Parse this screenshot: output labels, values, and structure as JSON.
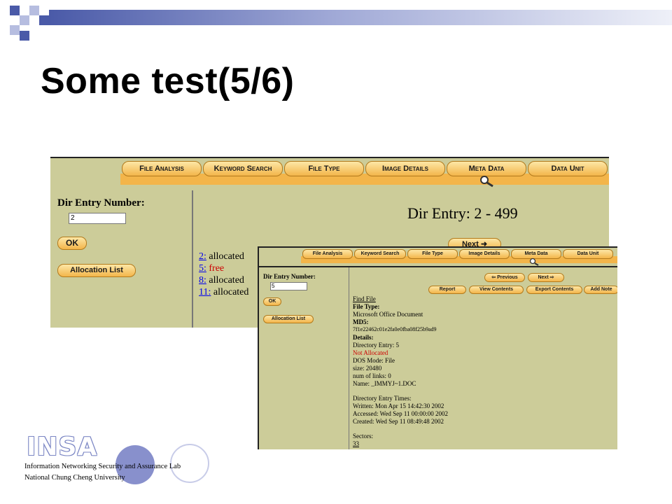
{
  "slide": {
    "title": "Some test(5/6)",
    "footer_line1": "Information Networking Security and Assurance Lab",
    "footer_line2": "National Chung Cheng University",
    "logo_text": "INSA",
    "colors": {
      "deco_blue": "#4a5aa8",
      "panel": "#cccc99",
      "tab": "#f3b54a",
      "logo": "#8890cc"
    }
  },
  "screen1": {
    "tabs": [
      "File Analysis",
      "Keyword Search",
      "File Type",
      "Image Details",
      "Meta Data",
      "Data Unit"
    ],
    "magnifier_icon": "magnifier-icon",
    "dir_entry_label": "Dir Entry Number:",
    "dir_entry_value": "2",
    "ok_label": "OK",
    "allocation_list_label": "Allocation List",
    "heading": "Dir Entry: 2 - 499",
    "next_label": "Next",
    "entries": [
      {
        "num": "2:",
        "status": "allocated",
        "status_color": "#000000"
      },
      {
        "num": "5:",
        "status": "free",
        "status_color": "#cc0000"
      },
      {
        "num": "8:",
        "status": "allocated",
        "status_color": "#000000"
      },
      {
        "num": "11:",
        "status": "allocated",
        "status_color": "#000000"
      }
    ]
  },
  "screen2": {
    "tabs": [
      "File Analysis",
      "Keyword Search",
      "File Type",
      "Image Details",
      "Meta Data",
      "Data Unit"
    ],
    "dir_entry_label": "Dir Entry Number:",
    "dir_entry_value": "5",
    "ok_label": "OK",
    "allocation_list_label": "Allocation List",
    "previous_label": "Previous",
    "next_label": "Next",
    "actions": [
      "Report",
      "View Contents",
      "Export Contents",
      "Add Note"
    ],
    "find_file": "Find File",
    "file_type_label": "File Type:",
    "file_type_value": "Microsoft Office Document",
    "md5_label": "MD5:",
    "md5_value": "7f1e22462c01e2fa0e0fba08f25b9ad9",
    "details_label": "Details:",
    "directory_entry": "Directory Entry: 5",
    "not_allocated": "Not Allocated",
    "dos_mode": "DOS Mode: File",
    "size": "size: 20480",
    "num_links": "num of links: 0",
    "name": "Name: _IMMYJ~1.DOC",
    "times_label": "Directory Entry Times:",
    "written": "Written: Mon Apr 15 14:42:30 2002",
    "accessed": "Accessed: Wed Sep 11 00:00:00 2002",
    "created": "Created: Wed Sep 11 08:49:48 2002",
    "sectors_label": "Sectors:",
    "sector_value": "33"
  }
}
